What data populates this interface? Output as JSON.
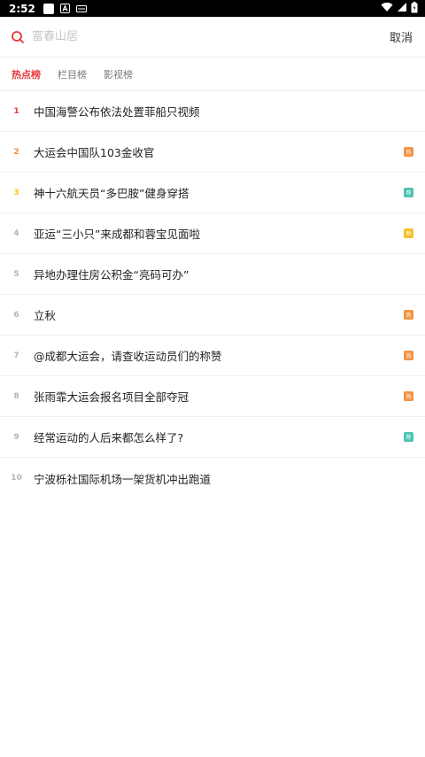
{
  "status_bar": {
    "time": "2:52",
    "icons": [
      "app-notification-icon",
      "text-a-icon",
      "sim-mini-icon",
      "wifi-icon",
      "signal-icon",
      "battery-icon"
    ]
  },
  "search": {
    "placeholder": "富春山居",
    "cancel_label": "取消"
  },
  "tabs": [
    {
      "label": "热点榜",
      "active": true
    },
    {
      "label": "栏目榜",
      "active": false
    },
    {
      "label": "影视榜",
      "active": false
    }
  ],
  "colors": {
    "accent": "#e8383d",
    "rank1": "#e8383d",
    "rank2": "#f08a31",
    "rank3": "#f5c518",
    "rank_other": "#b5b5b5",
    "badge_hot": "#f39343",
    "badge_rec": "#4cc3b1",
    "badge_new": "#f6c02a"
  },
  "list": [
    {
      "rank": "1",
      "title": "中国海警公布依法处置菲船只视频",
      "badge": ""
    },
    {
      "rank": "2",
      "title": "大运会中国队103金收官",
      "badge": "热"
    },
    {
      "rank": "3",
      "title": "神十六航天员“多巴胺”健身穿搭",
      "badge": "荐"
    },
    {
      "rank": "4",
      "title": "亚运“三小只”来成都和蓉宝见面啦",
      "badge": "新"
    },
    {
      "rank": "5",
      "title": "异地办理住房公积金“亮码可办”",
      "badge": ""
    },
    {
      "rank": "6",
      "title": "立秋",
      "badge": "热"
    },
    {
      "rank": "7",
      "title": "@成都大运会，请查收运动员们的称赞",
      "badge": "热"
    },
    {
      "rank": "8",
      "title": "张雨霏大运会报名项目全部夺冠",
      "badge": "热"
    },
    {
      "rank": "9",
      "title": "经常运动的人后来都怎么样了?",
      "badge": "荐"
    },
    {
      "rank": "10",
      "title": "宁波栎社国际机场一架货机冲出跑道",
      "badge": ""
    }
  ]
}
